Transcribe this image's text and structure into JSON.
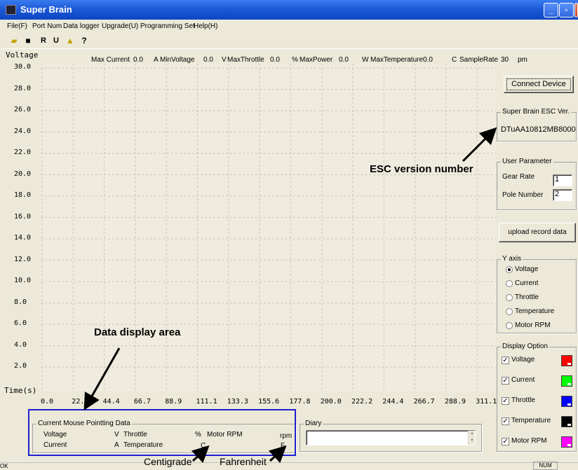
{
  "window": {
    "title": "Super Brain"
  },
  "menu": [
    "File(F)",
    "Port Num",
    "Data logger",
    "Upgrade(U)",
    "Programming Set",
    "Help(H)"
  ],
  "toolbar": {
    "icons": [
      "open-folder-icon",
      "save-icon",
      "record-icon",
      "upload-icon",
      "export-icon",
      "help-icon"
    ]
  },
  "maxbar": {
    "current_label": "Max Current",
    "current_value": "0.0",
    "current_unit": "A",
    "voltage_label": "MinVoltage",
    "voltage_value": "0.0",
    "voltage_unit": "V",
    "throttle_label": "MaxThrottle",
    "throttle_value": "0.0",
    "throttle_unit": "%",
    "power_label": "MaxPower",
    "power_value": "0.0",
    "power_unit": "W",
    "temp_label": "MaxTemperature",
    "temp_value": "0.0",
    "temp_unit": "C",
    "sample_label": "SampleRate",
    "sample_value": "30",
    "sample_unit": "pm"
  },
  "chart_data": {
    "type": "line",
    "ylabel": "Voltage",
    "xlabel": "Time(s)",
    "ylim": [
      0,
      30
    ],
    "xlim": [
      0,
      311.1
    ],
    "y_ticks": [
      "30.0",
      "28.0",
      "26.0",
      "24.0",
      "22.0",
      "20.0",
      "18.0",
      "16.0",
      "14.0",
      "12.0",
      "10.0",
      "8.0",
      "6.0",
      "4.0",
      "2.0"
    ],
    "x_ticks": [
      "0.0",
      "22.2",
      "44.4",
      "66.7",
      "88.9",
      "111.1",
      "133.3",
      "155.6",
      "177.8",
      "200.0",
      "222.2",
      "244.4",
      "266.7",
      "288.9",
      "311.1"
    ],
    "grid": true,
    "series": []
  },
  "right_panel": {
    "connect_button": "Connect Device",
    "esc_group": "Super Brain ESC Ver.",
    "esc_version": "DTuAA10812MB8000",
    "user_param_group": "User Parameter",
    "gear_rate_label": "Gear Rate",
    "gear_rate_value": "1",
    "pole_number_label": "Pole Number",
    "pole_number_value": "2",
    "upload_button": "upload record data",
    "y_axis_group": "Y axis",
    "y_axis_options": [
      "Voltage",
      "Current",
      "Throttle",
      "Temperature",
      "Motor RPM"
    ],
    "y_axis_selected": "Voltage",
    "display_group": "Display Option",
    "display_options": [
      {
        "label": "Voltage",
        "checked": true,
        "color": "#ff0000"
      },
      {
        "label": "Current",
        "checked": true,
        "color": "#00ff00"
      },
      {
        "label": "Throttle",
        "checked": true,
        "color": "#0000ff"
      },
      {
        "label": "Temperature",
        "checked": true,
        "color": "#000000"
      },
      {
        "label": "Motor RPM",
        "checked": true,
        "color": "#ff00ff"
      }
    ]
  },
  "mouse_data": {
    "group": "Current Mouse Pointting Data",
    "voltage_label": "Voltage",
    "voltage_unit": "V",
    "throttle_label": "Throttle",
    "throttle_unit": "%",
    "rpm_label": "Motor RPM",
    "rpm_unit": "rpm",
    "current_label": "Current",
    "current_unit": "A",
    "temp_label": "Temperature",
    "temp_c": "C",
    "temp_f": "F"
  },
  "diary": {
    "label": "Diary"
  },
  "status": {
    "left": "OK",
    "num": "NUM"
  },
  "annotations": {
    "esc_version": "ESC version number",
    "data_display": "Data display area",
    "centigrade": "Centigrade",
    "fahrenheit": "Fahrenheit"
  },
  "colors": {
    "plot_bg": "#efecdf",
    "window_bg": "#ece9d8",
    "highlight_box": "#2020d0"
  }
}
